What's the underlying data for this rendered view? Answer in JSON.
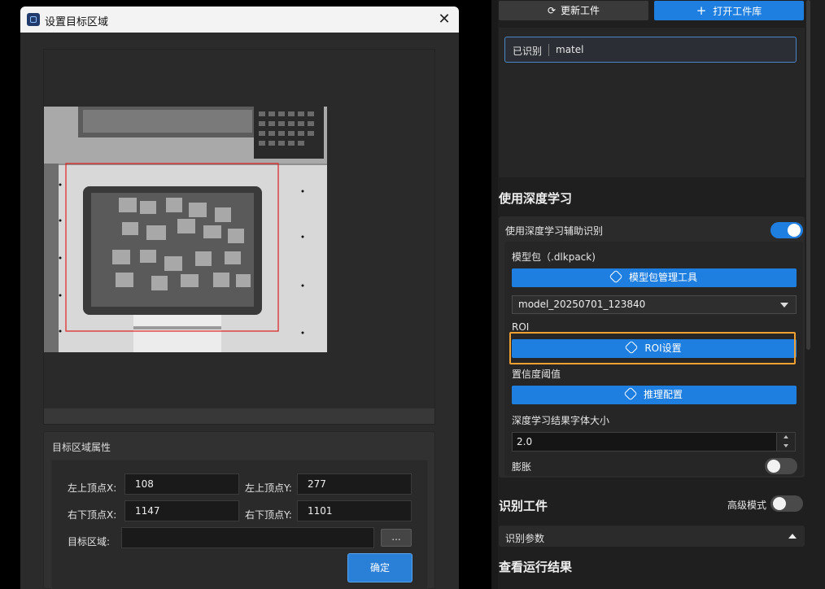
{
  "dialog": {
    "title": "设置目标区域",
    "close_symbol": "✕",
    "props_title": "目标区域属性",
    "fields": {
      "top_left_x_label": "左上顶点X:",
      "top_left_x_value": "108",
      "top_left_y_label": "左上顶点Y:",
      "top_left_y_value": "277",
      "bottom_right_x_label": "右下顶点X:",
      "bottom_right_x_value": "1147",
      "bottom_right_y_label": "右下顶点Y:",
      "bottom_right_y_value": "1101",
      "region_label": "目标区域:",
      "region_value": "",
      "browse_label": "...",
      "ok_label": "确定"
    }
  },
  "panel": {
    "refresh_label": "更新工件",
    "open_library_label": "打开工件库",
    "recognized_key": "已识别",
    "recognized_value": "matel",
    "deep_learning_title": "使用深度学习",
    "use_dl_label": "使用深度学习辅助识别",
    "use_dl_on": true,
    "model_pack_label": "模型包（.dlkpack)",
    "model_tool_button": "模型包管理工具",
    "model_selected": "model_20250701_123840",
    "roi_label": "ROI",
    "roi_button": "ROI设置",
    "confidence_label": "置信度阈值",
    "inference_button": "推理配置",
    "font_size_label": "深度学习结果字体大小",
    "font_size_value": "2.0",
    "dilate_label": "膨胀",
    "dilate_on": false,
    "recognize_title": "识别工件",
    "advanced_mode_label": "高级模式",
    "advanced_on": false,
    "recognize_params_label": "识别参数",
    "results_title": "查看运行结果"
  },
  "colors": {
    "accent": "#1f7fe0",
    "highlight": "#f0a030",
    "roi_rect": "#e02020"
  }
}
